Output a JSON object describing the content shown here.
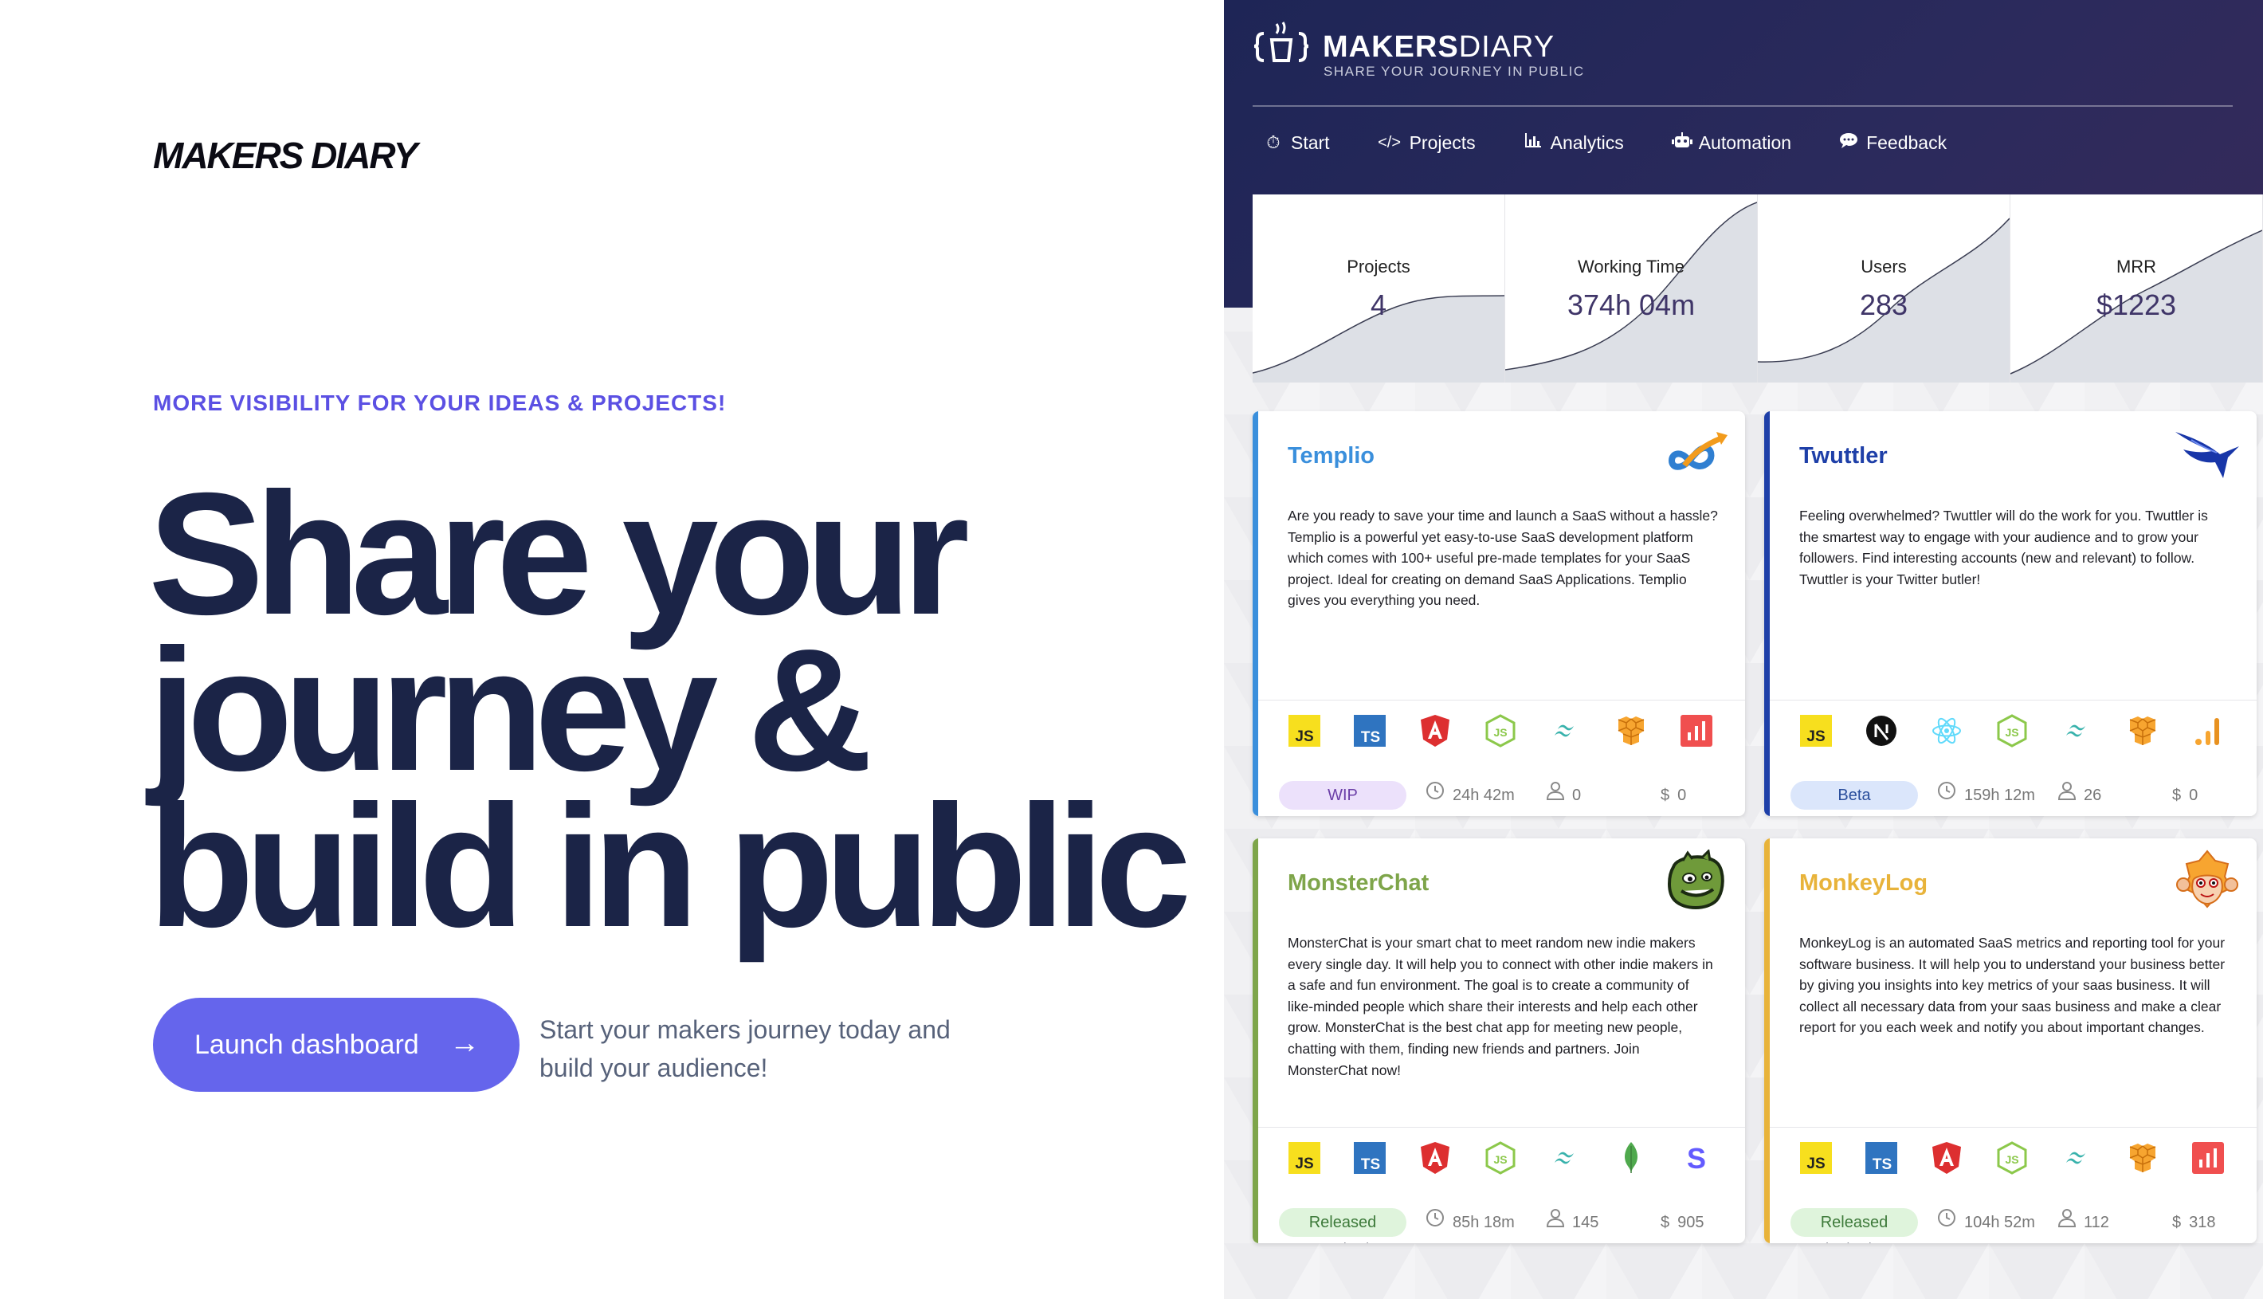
{
  "hero": {
    "brand": "MAKERS DIARY",
    "eyebrow": "MORE VISIBILITY FOR YOUR IDEAS & PROJECTS!",
    "headline_lines": [
      "Share your",
      "journey &",
      "build in public"
    ],
    "cta_label": "Launch dashboard",
    "cta_arrow": "→",
    "subtext": "Start your makers journey today and build your audience!"
  },
  "dashboard": {
    "logo_name_bold": "MAKERS",
    "logo_name_light": "DIARY",
    "logo_tagline": "SHARE YOUR JOURNEY IN PUBLIC",
    "nav": [
      {
        "icon": "stopwatch-icon",
        "label": "Start"
      },
      {
        "icon": "code-icon",
        "label": "Projects"
      },
      {
        "icon": "bar-chart-icon",
        "label": "Analytics"
      },
      {
        "icon": "robot-icon",
        "label": "Automation"
      },
      {
        "icon": "comment-icon",
        "label": "Feedback"
      }
    ],
    "stats": [
      {
        "label": "Projects",
        "value": "4"
      },
      {
        "label": "Working Time",
        "value": "374h 04m"
      },
      {
        "label": "Users",
        "value": "283"
      },
      {
        "label": "MRR",
        "value": "$1223"
      }
    ],
    "projects": [
      {
        "name": "Templio",
        "color": "#3a8fdc",
        "logo": "infinity-arrow-logo",
        "description": "Are you ready to save your time and launch a SaaS without a hassle? Templio is a powerful yet easy-to-use SaaS development platform which comes with 100+ useful pre-made templates for your SaaS project. Ideal for creating on demand SaaS Applications. Templio gives you everything you need.",
        "url": "templio.com",
        "techs": [
          "JS",
          "TS",
          "angular",
          "nodejs",
          "tailwind",
          "aws",
          "chart"
        ],
        "status": "WIP",
        "status_bg": "#ece1fb",
        "status_fg": "#6b3fa7",
        "time": "24h 42m",
        "users": "0",
        "currency": "$",
        "revenue": "0"
      },
      {
        "name": "Twuttler",
        "color": "#1e3fa8",
        "logo": "bird-logo",
        "description": "Feeling overwhelmed? Twuttler will do the work for you. Twuttler is the smartest way to engage with your audience and to grow your followers. Find interesting accounts (new and relevant) to follow. Twuttler is your Twitter butler!",
        "url": "twuttler.com",
        "techs": [
          "JS",
          "next",
          "react",
          "nodejs",
          "tailwind",
          "aws",
          "signal"
        ],
        "status": "Beta",
        "status_bg": "#dbe6fb",
        "status_fg": "#2a4e9c",
        "time": "159h 12m",
        "users": "26",
        "currency": "$",
        "revenue": "0"
      },
      {
        "name": "MonsterChat",
        "color": "#7ea54a",
        "logo": "monster-logo",
        "description": "MonsterChat is your smart chat to meet random new indie makers every single day. It will help you to connect with other indie makers in a safe and fun environment. The goal is to create a community of like-minded people which share their interests and help each other grow. MonsterChat is the best chat app for meeting new people, chatting with them, finding new friends and partners. Join MonsterChat now!",
        "url": "monsterchat.io",
        "techs": [
          "JS",
          "TS",
          "angular",
          "nodejs",
          "tailwind",
          "mongodb",
          "stripe"
        ],
        "status": "Released",
        "status_bg": "#dff4dc",
        "status_fg": "#3d7a3a",
        "time": "85h 18m",
        "users": "145",
        "currency": "$",
        "revenue": "905"
      },
      {
        "name": "MonkeyLog",
        "color": "#e8b33a",
        "logo": "monkey-logo",
        "description": "MonkeyLog is an automated SaaS metrics and reporting tool for your software business. It will help you to understand your business better by giving you insights into key metrics of your saas business. It will collect all necessary data from your saas business and make a clear report for you each week and notify you about important changes.",
        "url": "monkeylog.io",
        "techs": [
          "JS",
          "TS",
          "angular",
          "nodejs",
          "tailwind",
          "aws",
          "chart"
        ],
        "status": "Released",
        "status_bg": "#dff4dc",
        "status_fg": "#3d7a3a",
        "time": "104h 52m",
        "users": "112",
        "currency": "$",
        "revenue": "318"
      }
    ]
  }
}
